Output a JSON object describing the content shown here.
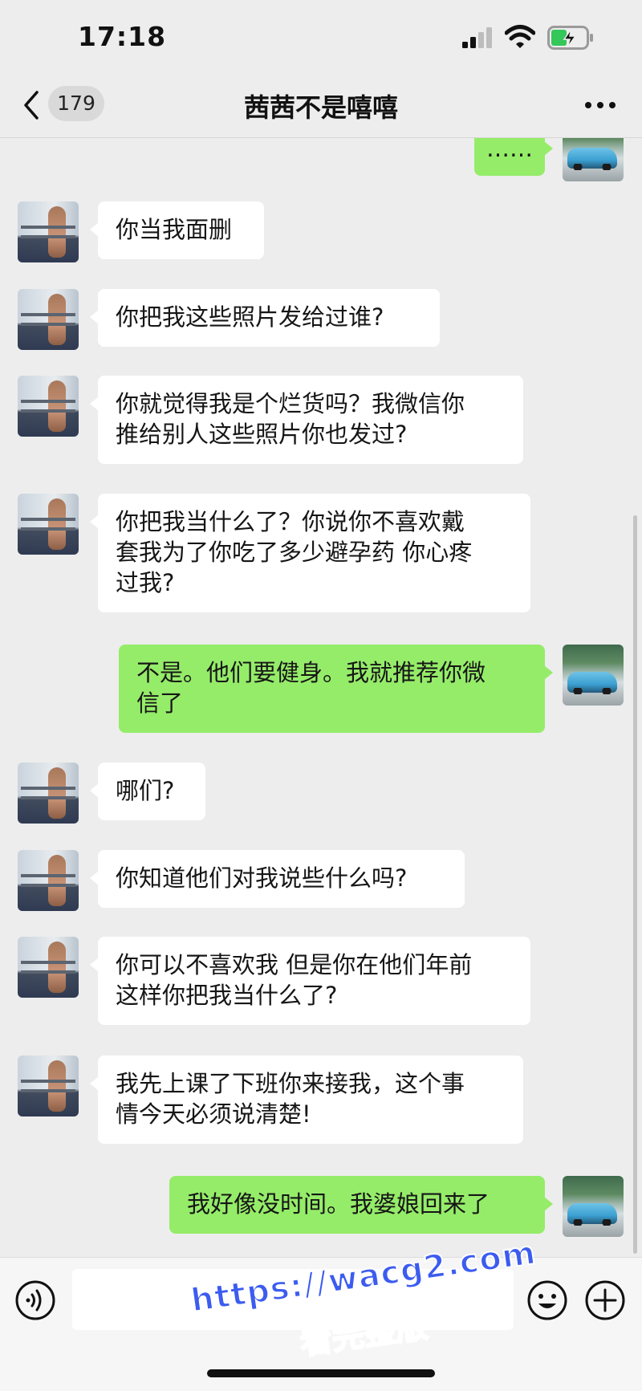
{
  "status_bar": {
    "time": "17:18"
  },
  "nav": {
    "unread_count": "179",
    "title": "茜茜不是嘻嘻"
  },
  "messages": [
    {
      "from": "me",
      "text": "……"
    },
    {
      "from": "her",
      "text": "你当我面删"
    },
    {
      "from": "her",
      "text": "你把我这些照片发给过谁?"
    },
    {
      "from": "her",
      "text": "你就觉得我是个烂货吗？我微信你\n推给别人这些照片你也发过?"
    },
    {
      "from": "her",
      "text": "你把我当什么了？你说你不喜欢戴\n套我为了你吃了多少避孕药 你心疼\n过我?"
    },
    {
      "from": "me",
      "text": "不是。他们要健身。我就推荐你微\n信了"
    },
    {
      "from": "her",
      "text": "哪们?"
    },
    {
      "from": "her",
      "text": "你知道他们对我说些什么吗?"
    },
    {
      "from": "her",
      "text": "你可以不喜欢我 但是你在他们年前\n这样你把我当什么了?"
    },
    {
      "from": "her",
      "text": "我先上课了下班你来接我，这个事\n情今天必须说清楚!"
    },
    {
      "from": "me",
      "text": "我好像没时间。我婆娘回来了"
    }
  ],
  "input": {
    "value": "",
    "placeholder": ""
  },
  "icons": {
    "back": "chevron-left-icon",
    "more": "more-dots-icon",
    "voice": "voice-icon",
    "emoji": "emoji-icon",
    "plus": "plus-icon"
  },
  "colors": {
    "background": "#ededed",
    "incoming_bubble": "#ffffff",
    "outgoing_bubble": "#95ec69",
    "watermark": "#3c5cf0"
  },
  "watermark": {
    "line1": "https://wacg2.com",
    "line2": "看完整版"
  }
}
